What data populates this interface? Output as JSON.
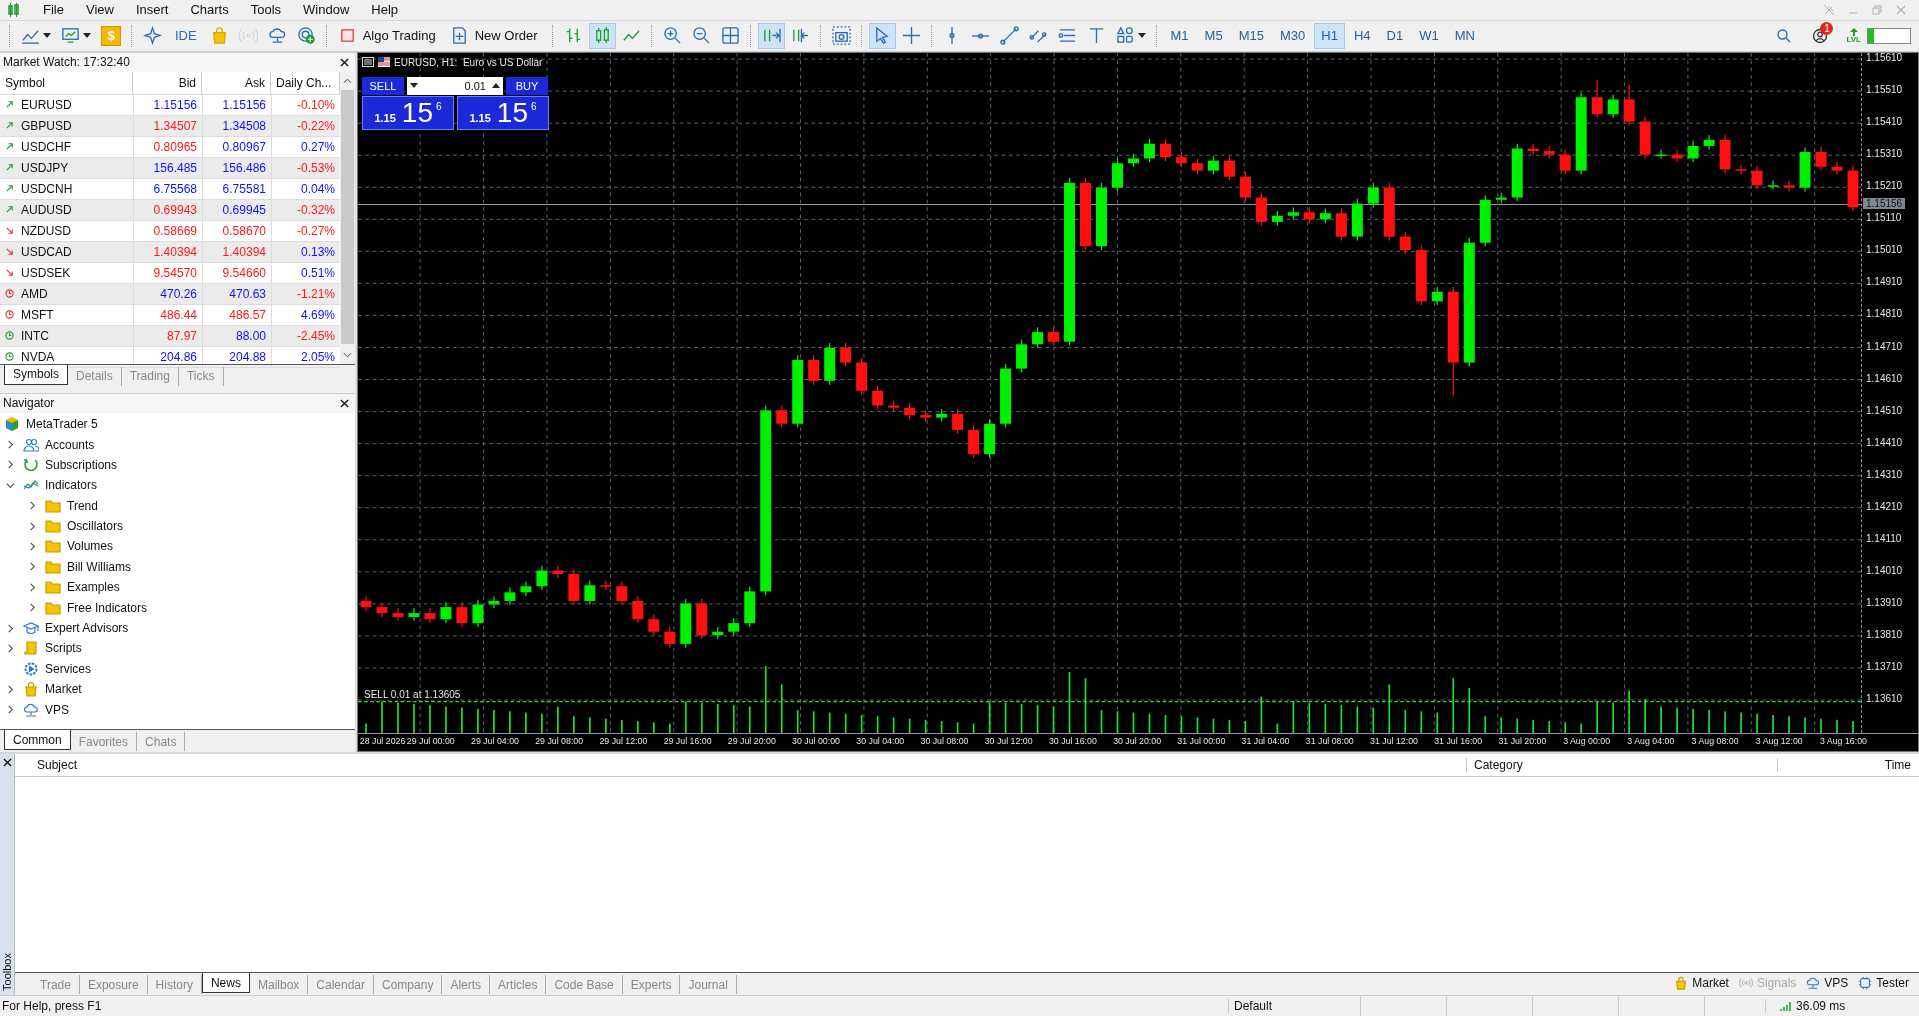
{
  "menu": [
    "File",
    "View",
    "Insert",
    "Charts",
    "Tools",
    "Window",
    "Help"
  ],
  "toolbar": {
    "groups": [
      [
        {
          "kind": "new-chart",
          "selected": false,
          "disabled": false
        },
        {
          "kind": "profiles",
          "selected": false,
          "disabled": false
        },
        {
          "kind": "coin",
          "label": "$",
          "selected": false,
          "disabled": false
        }
      ],
      [
        {
          "kind": "sparkle",
          "selected": false,
          "disabled": false
        },
        {
          "kind": "ide",
          "label": "IDE",
          "selected": false,
          "disabled": false
        },
        {
          "kind": "bag",
          "selected": false,
          "disabled": false
        },
        {
          "kind": "signal",
          "selected": false,
          "disabled": true
        },
        {
          "kind": "cloud",
          "selected": false,
          "disabled": false
        },
        {
          "kind": "target",
          "selected": false,
          "disabled": false
        }
      ],
      [
        {
          "kind": "algo",
          "label": "Algo Trading",
          "selected": false,
          "disabled": false
        },
        {
          "kind": "order",
          "label": "New Order",
          "selected": false,
          "disabled": false
        }
      ],
      [
        {
          "kind": "bars",
          "selected": false,
          "disabled": false
        },
        {
          "kind": "candles",
          "selected": true,
          "disabled": false
        },
        {
          "kind": "line",
          "selected": false,
          "disabled": false
        }
      ],
      [
        {
          "kind": "zoom-in",
          "selected": false,
          "disabled": false
        },
        {
          "kind": "zoom-out",
          "selected": false,
          "disabled": false
        },
        {
          "kind": "tile",
          "selected": false,
          "disabled": false
        }
      ],
      [
        {
          "kind": "autoscroll",
          "selected": true,
          "disabled": false
        },
        {
          "kind": "shift",
          "selected": false,
          "disabled": false
        }
      ],
      [
        {
          "kind": "camera",
          "selected": false,
          "disabled": false
        }
      ],
      [
        {
          "kind": "cursor",
          "selected": true,
          "disabled": false
        },
        {
          "kind": "crosshair",
          "selected": false,
          "disabled": false
        }
      ],
      [
        {
          "kind": "vline",
          "selected": false,
          "disabled": false
        },
        {
          "kind": "hline",
          "selected": false,
          "disabled": false
        },
        {
          "kind": "trend",
          "selected": false,
          "disabled": false
        },
        {
          "kind": "channel",
          "selected": false,
          "disabled": false
        },
        {
          "kind": "fibo",
          "selected": false,
          "disabled": false
        },
        {
          "kind": "text",
          "selected": false,
          "disabled": false
        },
        {
          "kind": "shapes",
          "selected": false,
          "disabled": false
        }
      ]
    ],
    "timeframes": [
      {
        "label": "M1",
        "selected": false
      },
      {
        "label": "M5",
        "selected": false
      },
      {
        "label": "M15",
        "selected": false
      },
      {
        "label": "M30",
        "selected": false
      },
      {
        "label": "H1",
        "selected": true
      },
      {
        "label": "H4",
        "selected": false
      },
      {
        "label": "D1",
        "selected": false
      },
      {
        "label": "W1",
        "selected": false
      },
      {
        "label": "MN",
        "selected": false
      }
    ],
    "notifications": "1",
    "level_label": "LVL"
  },
  "market_watch": {
    "title": "Market Watch: 17:32:40",
    "columns": [
      "Symbol",
      "Bid",
      "Ask",
      "Daily Ch..."
    ],
    "rows": [
      {
        "symbol": "EURUSD",
        "kind": "forex",
        "up": true,
        "bid": "1.15156",
        "bid_up": true,
        "ask": "1.15156",
        "ask_up": true,
        "change": "-0.10%",
        "change_up": false
      },
      {
        "symbol": "GBPUSD",
        "kind": "forex",
        "up": true,
        "bid": "1.34507",
        "bid_up": false,
        "ask": "1.34508",
        "ask_up": true,
        "change": "-0.22%",
        "change_up": false
      },
      {
        "symbol": "USDCHF",
        "kind": "forex",
        "up": true,
        "bid": "0.80965",
        "bid_up": false,
        "ask": "0.80967",
        "ask_up": true,
        "change": "0.27%",
        "change_up": true
      },
      {
        "symbol": "USDJPY",
        "kind": "forex",
        "up": true,
        "bid": "156.485",
        "bid_up": true,
        "ask": "156.486",
        "ask_up": true,
        "change": "-0.53%",
        "change_up": false
      },
      {
        "symbol": "USDCNH",
        "kind": "forex",
        "up": true,
        "bid": "6.75568",
        "bid_up": true,
        "ask": "6.75581",
        "ask_up": true,
        "change": "0.04%",
        "change_up": true
      },
      {
        "symbol": "AUDUSD",
        "kind": "forex",
        "up": true,
        "bid": "0.69943",
        "bid_up": false,
        "ask": "0.69945",
        "ask_up": true,
        "change": "-0.32%",
        "change_up": false
      },
      {
        "symbol": "NZDUSD",
        "kind": "forex",
        "up": false,
        "bid": "0.58669",
        "bid_up": false,
        "ask": "0.58670",
        "ask_up": false,
        "change": "-0.27%",
        "change_up": false
      },
      {
        "symbol": "USDCAD",
        "kind": "forex",
        "up": false,
        "bid": "1.40394",
        "bid_up": false,
        "ask": "1.40394",
        "ask_up": false,
        "change": "0.13%",
        "change_up": true
      },
      {
        "symbol": "USDSEK",
        "kind": "forex",
        "up": false,
        "bid": "9.54570",
        "bid_up": false,
        "ask": "9.54660",
        "ask_up": false,
        "change": "0.51%",
        "change_up": true
      },
      {
        "symbol": "AMD",
        "kind": "stock",
        "up": false,
        "bid": "470.26",
        "bid_up": true,
        "ask": "470.63",
        "ask_up": true,
        "change": "-1.21%",
        "change_up": false
      },
      {
        "symbol": "MSFT",
        "kind": "stock",
        "up": false,
        "bid": "486.44",
        "bid_up": false,
        "ask": "486.57",
        "ask_up": false,
        "change": "4.69%",
        "change_up": true
      },
      {
        "symbol": "INTC",
        "kind": "stock",
        "up": true,
        "bid": "87.97",
        "bid_up": false,
        "ask": "88.00",
        "ask_up": true,
        "change": "-2.45%",
        "change_up": false
      },
      {
        "symbol": "NVDA",
        "kind": "stock",
        "up": true,
        "bid": "204.86",
        "bid_up": true,
        "ask": "204.88",
        "ask_up": true,
        "change": "2.05%",
        "change_up": true
      }
    ],
    "tabs": [
      {
        "label": "Symbols",
        "selected": true
      },
      {
        "label": "Details",
        "selected": false
      },
      {
        "label": "Trading",
        "selected": false
      },
      {
        "label": "Ticks",
        "selected": false
      }
    ]
  },
  "navigator": {
    "title": "Navigator",
    "root": {
      "label": "MetaTrader 5"
    },
    "items": [
      {
        "label": "Accounts",
        "kind": "accounts",
        "expanded": false
      },
      {
        "label": "Subscriptions",
        "kind": "subscriptions",
        "expanded": false
      },
      {
        "label": "Indicators",
        "kind": "indicators",
        "expanded": true,
        "children": [
          {
            "label": "Trend",
            "kind": "folder",
            "expanded": false
          },
          {
            "label": "Oscillators",
            "kind": "folder",
            "expanded": false
          },
          {
            "label": "Volumes",
            "kind": "folder",
            "expanded": false
          },
          {
            "label": "Bill Williams",
            "kind": "folder",
            "expanded": false
          },
          {
            "label": "Examples",
            "kind": "folder",
            "expanded": false
          },
          {
            "label": "Free Indicators",
            "kind": "folder",
            "expanded": false
          }
        ]
      },
      {
        "label": "Expert Advisors",
        "kind": "experts",
        "expanded": false
      },
      {
        "label": "Scripts",
        "kind": "scripts",
        "expanded": false
      },
      {
        "label": "Services",
        "kind": "services"
      },
      {
        "label": "Market",
        "kind": "market",
        "expanded": false
      },
      {
        "label": "VPS",
        "kind": "vps",
        "expanded": false
      }
    ],
    "tabs": [
      {
        "label": "Common",
        "selected": true
      },
      {
        "label": "Favorites",
        "selected": false
      },
      {
        "label": "Chats",
        "selected": false
      }
    ]
  },
  "chart": {
    "title": "EURUSD, H1:  Euro vs US Dollar",
    "trade_panel": {
      "sell_label": "SELL",
      "buy_label": "BUY",
      "volume": "0.01",
      "sell_price": {
        "head": "1.15",
        "big": "15",
        "tail": "6"
      },
      "buy_price": {
        "head": "1.15",
        "big": "15",
        "tail": "6"
      }
    },
    "order_label": "SELL 0.01 at 1.13605",
    "current_price": "1.15156",
    "chart_data": {
      "type": "candlestick",
      "categories": [
        null,
        "28 Jul 2026",
        null,
        null,
        "29 Jul 00:00",
        null,
        null,
        null,
        "29 Jul 04:00",
        null,
        null,
        null,
        "29 Jul 08:00",
        null,
        null,
        null,
        "29 Jul 12:00",
        null,
        null,
        null,
        "29 Jul 16:00",
        null,
        null,
        null,
        "29 Jul 20:00",
        null,
        null,
        null,
        "30 Jul 00:00",
        null,
        null,
        null,
        "30 Jul 04:00",
        null,
        null,
        null,
        "30 Jul 08:00",
        null,
        null,
        null,
        "30 Jul 12:00",
        null,
        null,
        null,
        "30 Jul 16:00",
        null,
        null,
        null,
        "30 Jul 20:00",
        null,
        null,
        null,
        "31 Jul 00:00",
        null,
        null,
        null,
        "31 Jul 04:00",
        null,
        null,
        null,
        "31 Jul 08:00",
        null,
        null,
        null,
        "31 Jul 12:00",
        null,
        null,
        null,
        "31 Jul 16:00",
        null,
        null,
        null,
        "31 Jul 20:00",
        null,
        null,
        null,
        "3 Aug 00:00",
        null,
        null,
        null,
        "3 Aug 04:00",
        null,
        null,
        null,
        "3 Aug 08:00",
        null,
        null,
        null,
        "3 Aug 12:00",
        null,
        null,
        null,
        "3 Aug 16:00",
        null
      ],
      "ylim": [
        1.13506,
        1.15629
      ],
      "grid": true,
      "ref_lines": [
        {
          "axis": "y",
          "value": 1.15156,
          "color": "#8a96a3"
        },
        {
          "axis": "y",
          "value": 1.13605,
          "color": "#3fd03f"
        }
      ],
      "ohlc": [
        [
          1.13919,
          1.13934,
          1.13888,
          1.139
        ],
        [
          1.139,
          1.13915,
          1.13869,
          1.13881
        ],
        [
          1.13881,
          1.13896,
          1.13857,
          1.13869
        ],
        [
          1.13869,
          1.13896,
          1.13857,
          1.13881
        ],
        [
          1.13881,
          1.13896,
          1.1385,
          1.13862
        ],
        [
          1.13862,
          1.13915,
          1.1385,
          1.139
        ],
        [
          1.139,
          1.13915,
          1.13838,
          1.1385
        ],
        [
          1.1385,
          1.13923,
          1.13838,
          1.13908
        ],
        [
          1.13908,
          1.13934,
          1.13896,
          1.13919
        ],
        [
          1.13919,
          1.13961,
          1.13907,
          1.13946
        ],
        [
          1.13946,
          1.1398,
          1.13934,
          1.13965
        ],
        [
          1.13965,
          1.14029,
          1.13953,
          1.14014
        ],
        [
          1.14014,
          1.14029,
          1.13991,
          1.14003
        ],
        [
          1.14003,
          1.14018,
          1.13907,
          1.13919
        ],
        [
          1.13919,
          1.13983,
          1.13907,
          1.13968
        ],
        [
          1.13968,
          1.13983,
          1.13953,
          1.13965
        ],
        [
          1.13965,
          1.1398,
          1.13907,
          1.13919
        ],
        [
          1.13919,
          1.13934,
          1.1385,
          1.13862
        ],
        [
          1.13862,
          1.13877,
          1.13811,
          1.13823
        ],
        [
          1.13823,
          1.13838,
          1.13773,
          1.13785
        ],
        [
          1.13785,
          1.13926,
          1.13773,
          1.13911
        ],
        [
          1.13911,
          1.13926,
          1.138,
          1.13812
        ],
        [
          1.13812,
          1.13838,
          1.138,
          1.13823
        ],
        [
          1.13823,
          1.13865,
          1.13811,
          1.1385
        ],
        [
          1.1385,
          1.13964,
          1.13838,
          1.13949
        ],
        [
          1.13949,
          1.14529,
          1.13937,
          1.14514
        ],
        [
          1.14514,
          1.14529,
          1.1446,
          1.14472
        ],
        [
          1.14472,
          1.14686,
          1.1446,
          1.14671
        ],
        [
          1.14671,
          1.14686,
          1.14594,
          1.14606
        ],
        [
          1.14606,
          1.14724,
          1.14594,
          1.14709
        ],
        [
          1.14709,
          1.14724,
          1.14651,
          1.14663
        ],
        [
          1.14663,
          1.14678,
          1.14563,
          1.14575
        ],
        [
          1.14575,
          1.1459,
          1.14517,
          1.14529
        ],
        [
          1.14529,
          1.14544,
          1.1451,
          1.14522
        ],
        [
          1.14522,
          1.14537,
          1.14487,
          1.14499
        ],
        [
          1.14499,
          1.14514,
          1.14479,
          1.14491
        ],
        [
          1.14491,
          1.14518,
          1.14479,
          1.14503
        ],
        [
          1.14503,
          1.14518,
          1.14441,
          1.14453
        ],
        [
          1.14453,
          1.14468,
          1.14365,
          1.14377
        ],
        [
          1.14377,
          1.14487,
          1.14365,
          1.14472
        ],
        [
          1.14472,
          1.14659,
          1.1446,
          1.14644
        ],
        [
          1.14644,
          1.14735,
          1.14632,
          1.1472
        ],
        [
          1.1472,
          1.14773,
          1.14708,
          1.14758
        ],
        [
          1.14758,
          1.14773,
          1.14716,
          1.14728
        ],
        [
          1.14728,
          1.15239,
          1.14716,
          1.15224
        ],
        [
          1.15224,
          1.15239,
          1.15014,
          1.15026
        ],
        [
          1.15026,
          1.15224,
          1.15014,
          1.15209
        ],
        [
          1.15209,
          1.153,
          1.15197,
          1.15285
        ],
        [
          1.15285,
          1.15315,
          1.15273,
          1.153
        ],
        [
          1.153,
          1.15361,
          1.15288,
          1.15346
        ],
        [
          1.15346,
          1.15361,
          1.15292,
          1.15304
        ],
        [
          1.15304,
          1.15319,
          1.15273,
          1.15285
        ],
        [
          1.15285,
          1.153,
          1.1525,
          1.15262
        ],
        [
          1.15262,
          1.15308,
          1.1525,
          1.15293
        ],
        [
          1.15293,
          1.15308,
          1.15231,
          1.15243
        ],
        [
          1.15243,
          1.15258,
          1.15166,
          1.15178
        ],
        [
          1.15178,
          1.15193,
          1.1509,
          1.15102
        ],
        [
          1.15102,
          1.15136,
          1.1509,
          1.15121
        ],
        [
          1.15121,
          1.15147,
          1.15109,
          1.15132
        ],
        [
          1.15132,
          1.15147,
          1.15098,
          1.1511
        ],
        [
          1.1511,
          1.15144,
          1.15098,
          1.15129
        ],
        [
          1.15129,
          1.15144,
          1.15044,
          1.15056
        ],
        [
          1.15056,
          1.15174,
          1.15044,
          1.15159
        ],
        [
          1.15159,
          1.15224,
          1.15147,
          1.15209
        ],
        [
          1.15209,
          1.15224,
          1.15044,
          1.15056
        ],
        [
          1.15056,
          1.15071,
          1.15002,
          1.15014
        ],
        [
          1.15014,
          1.15029,
          1.14842,
          1.14854
        ],
        [
          1.14854,
          1.14899,
          1.14842,
          1.14884
        ],
        [
          1.14884,
          1.14899,
          1.1456,
          1.14663
        ],
        [
          1.14663,
          1.15052,
          1.14651,
          1.15037
        ],
        [
          1.15037,
          1.15186,
          1.15025,
          1.15171
        ],
        [
          1.15171,
          1.15193,
          1.15159,
          1.15178
        ],
        [
          1.15178,
          1.15346,
          1.15166,
          1.15331
        ],
        [
          1.15331,
          1.15346,
          1.15311,
          1.15323
        ],
        [
          1.15323,
          1.15338,
          1.153,
          1.15312
        ],
        [
          1.15312,
          1.15327,
          1.1525,
          1.15262
        ],
        [
          1.15262,
          1.15506,
          1.1525,
          1.15491
        ],
        [
          1.15491,
          1.15545,
          1.15426,
          1.15438
        ],
        [
          1.15438,
          1.15499,
          1.15426,
          1.15484
        ],
        [
          1.15484,
          1.1553,
          1.15403,
          1.15415
        ],
        [
          1.15415,
          1.1543,
          1.153,
          1.15312
        ],
        [
          1.15312,
          1.15327,
          1.153,
          1.15312
        ],
        [
          1.15312,
          1.15327,
          1.15288,
          1.153
        ],
        [
          1.153,
          1.15354,
          1.15288,
          1.15339
        ],
        [
          1.15339,
          1.15373,
          1.15327,
          1.15358
        ],
        [
          1.15358,
          1.15373,
          1.15254,
          1.15266
        ],
        [
          1.15266,
          1.15281,
          1.1525,
          1.15262
        ],
        [
          1.15262,
          1.15277,
          1.15204,
          1.15216
        ],
        [
          1.15216,
          1.15231,
          1.15204,
          1.15216
        ],
        [
          1.15216,
          1.15231,
          1.15197,
          1.15209
        ],
        [
          1.15209,
          1.15335,
          1.15197,
          1.1532
        ],
        [
          1.1532,
          1.15335,
          1.15262,
          1.15274
        ],
        [
          1.15274,
          1.15289,
          1.1525,
          1.15262
        ],
        [
          1.15262,
          1.15277,
          1.15136,
          1.15148
        ]
      ],
      "yticks": [
        {
          "value": 1.1561,
          "label": "1.15610"
        },
        {
          "value": 1.1551,
          "label": "1.15510"
        },
        {
          "value": 1.1541,
          "label": "1.15410"
        },
        {
          "value": 1.1531,
          "label": "1.15310"
        },
        {
          "value": 1.1521,
          "label": "1.15210"
        },
        {
          "value": 1.1511,
          "label": "1.15110"
        },
        {
          "value": 1.1501,
          "label": "1.15010"
        },
        {
          "value": 1.1491,
          "label": "1.14910"
        },
        {
          "value": 1.1481,
          "label": "1.14810"
        },
        {
          "value": 1.1471,
          "label": "1.14710"
        },
        {
          "value": 1.1461,
          "label": "1.14610"
        },
        {
          "value": 1.1451,
          "label": "1.14510"
        },
        {
          "value": 1.1441,
          "label": "1.14410"
        },
        {
          "value": 1.1431,
          "label": "1.14310"
        },
        {
          "value": 1.1421,
          "label": "1.14210"
        },
        {
          "value": 1.1411,
          "label": "1.14110"
        },
        {
          "value": 1.1401,
          "label": "1.14010"
        },
        {
          "value": 1.1391,
          "label": "1.13910"
        },
        {
          "value": 1.1381,
          "label": "1.13810"
        },
        {
          "value": 1.1371,
          "label": "1.13710"
        },
        {
          "value": 1.1361,
          "label": "1.13610"
        }
      ]
    }
  },
  "toolbox": {
    "title": "Toolbox",
    "columns": [
      "Subject",
      "Category",
      "Time"
    ],
    "tabs": [
      {
        "label": "Trade",
        "selected": false
      },
      {
        "label": "Exposure",
        "selected": false
      },
      {
        "label": "History",
        "selected": false
      },
      {
        "label": "News",
        "selected": true
      },
      {
        "label": "Mailbox",
        "selected": false
      },
      {
        "label": "Calendar",
        "selected": false
      },
      {
        "label": "Company",
        "selected": false
      },
      {
        "label": "Alerts",
        "selected": false
      },
      {
        "label": "Articles",
        "selected": false
      },
      {
        "label": "Code Base",
        "selected": false
      },
      {
        "label": "Experts",
        "selected": false
      },
      {
        "label": "Journal",
        "selected": false
      }
    ],
    "services": [
      {
        "label": "Market",
        "kind": "market",
        "disabled": false
      },
      {
        "label": "Signals",
        "kind": "signals",
        "disabled": true
      },
      {
        "label": "VPS",
        "kind": "vps",
        "disabled": false
      },
      {
        "label": "Tester",
        "kind": "tester",
        "disabled": false
      }
    ]
  },
  "status_bar": {
    "help": "For Help, press F1",
    "profile": "Default",
    "ping": "36.09 ms"
  }
}
